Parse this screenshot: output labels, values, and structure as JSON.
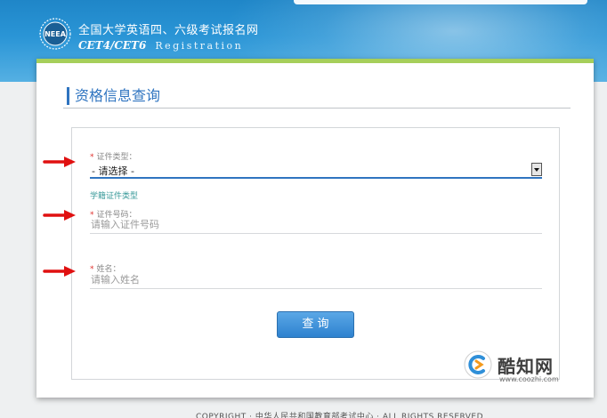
{
  "header": {
    "site_title": "全国大学英语四、六级考试报名网",
    "site_subtitle_cet": "CET4/CET6",
    "site_subtitle_reg": "Registration",
    "logo_text": "NEEA"
  },
  "page": {
    "title": "资格信息查询"
  },
  "form": {
    "id_type": {
      "required_mark": "*",
      "label": "证件类型：",
      "selected": "- 请选择 -",
      "hint": "学籍证件类型"
    },
    "id_number": {
      "required_mark": "*",
      "label": "证件号码：",
      "placeholder": "请输入证件号码"
    },
    "name": {
      "required_mark": "*",
      "label": "姓名：",
      "placeholder": "请输入姓名"
    },
    "query_button": "查  询"
  },
  "footer": {
    "copyright": "COPYRIGHT · 中华人民共和国教育部考试中心 · ALL RIGHTS RESERVED"
  },
  "watermark": {
    "brand": "酷知网",
    "url": "www.coozhi.com"
  },
  "colors": {
    "header_blue": "#2a95d6",
    "card_top_accent": "#a6cf5a",
    "title_blue": "#2f74c0",
    "required_red": "#e0332f",
    "annotation_arrow_red": "#e01010"
  },
  "icons": {
    "logo": "neea-logo-icon",
    "select_arrow": "chevron-down-icon",
    "annotation": "red-arrow-icon",
    "watermark": "coozhi-logo-icon"
  }
}
